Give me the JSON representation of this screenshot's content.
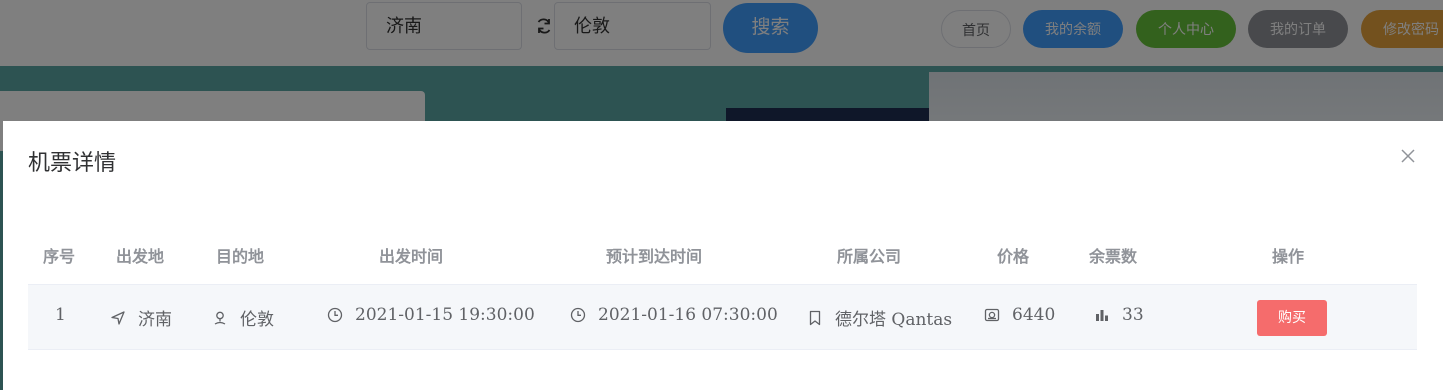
{
  "search": {
    "from_value": "济南",
    "to_value": "伦敦",
    "button_label": "搜索"
  },
  "nav": [
    {
      "label": "首页",
      "color": "#ffffff"
    },
    {
      "label": "我的余额",
      "color": "#409eff"
    },
    {
      "label": "个人中心",
      "color": "#67c23a"
    },
    {
      "label": "我的订单",
      "color": "#909399"
    },
    {
      "label": "修改密码",
      "color": "#e6a23c"
    }
  ],
  "dialog": {
    "title": "机票详情",
    "columns": [
      "序号",
      "出发地",
      "目的地",
      "出发时间",
      "预计到达时间",
      "所属公司",
      "价格",
      "余票数",
      "操作"
    ],
    "rows": [
      {
        "index": "1",
        "from": "济南",
        "to": "伦敦",
        "depart_time": "2021-01-15 19:30:00",
        "arrive_time": "2021-01-16 07:30:00",
        "company": "德尔塔 Qantas",
        "price": "6440",
        "remaining": "33",
        "action_label": "购买"
      }
    ]
  },
  "icons": {
    "from": "location-arrow-icon",
    "to": "map-pin-icon",
    "depart": "clock-icon",
    "arrive": "clock-icon",
    "company": "bookmark-icon",
    "price": "money-icon",
    "remaining": "bar-chart-icon"
  },
  "colors": {
    "primary": "#409eff",
    "success": "#67c23a",
    "info": "#909399",
    "warning": "#e6a23c",
    "danger": "#f56c6c",
    "header_text": "#909399",
    "cell_text": "#606266"
  }
}
